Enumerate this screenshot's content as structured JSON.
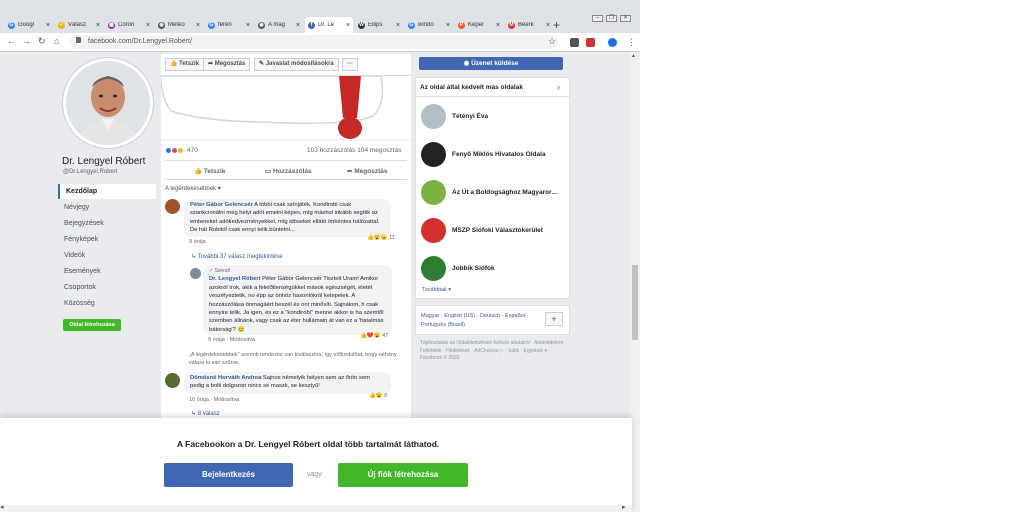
{
  "browser": {
    "tabs": [
      {
        "label": "Googl",
        "color": "#4285f4",
        "glyph": "G",
        "active": false
      },
      {
        "label": "Válasz",
        "color": "#f4b400",
        "glyph": "✓",
        "active": false
      },
      {
        "label": "Coron",
        "color": "#9c27b0",
        "glyph": "▦",
        "active": false
      },
      {
        "label": "Meteo",
        "color": "#555555",
        "glyph": "◉",
        "active": false
      },
      {
        "label": "feren",
        "color": "#4285f4",
        "glyph": "G",
        "active": false
      },
      {
        "label": "A mag",
        "color": "#555555",
        "glyph": "◉",
        "active": false
      },
      {
        "label": "Dr. Le",
        "color": "#4267b2",
        "glyph": "f",
        "active": true
      },
      {
        "label": "Ellips",
        "color": "#333333",
        "glyph": "W",
        "active": false
      },
      {
        "label": "windo",
        "color": "#4285f4",
        "glyph": "G",
        "active": false
      },
      {
        "label": "Képer",
        "color": "#ff5722",
        "glyph": "P",
        "active": false
      },
      {
        "label": "Beérk",
        "color": "#d93025",
        "glyph": "M",
        "active": false
      }
    ],
    "new_tab": "+",
    "url": "facebook.com/Dr.Lengyel.Robert/"
  },
  "profile": {
    "name": "Dr. Lengyel Róbert",
    "handle": "@Dr.Lengyel.Robert",
    "nav": [
      "Kezdőlap",
      "Névjegy",
      "Bejegyzések",
      "Fényképek",
      "Videók",
      "Események",
      "Csoportok",
      "Közösség"
    ],
    "create_page": "Oldal létrehozása"
  },
  "actions": {
    "like": "Tetszik",
    "share": "Megosztás",
    "suggest": "Javaslat módosításokra",
    "more": "···",
    "message": "Üzenet küldése"
  },
  "post": {
    "reactions": "470",
    "comments": "103 hozzászólás",
    "shares": "104 megosztás",
    "like_btn": "Tetszik",
    "comment_btn": "Hozzászólás",
    "share_btn": "Megosztás",
    "sort": "A legérdekesebbek ▾"
  },
  "comments": {
    "c1_name": "Péter Gábor Gelencsér",
    "c1_text": " A többi csak színjáték. Kondirobi csak szankcionálni meg helyi adót emelni képes, míg máshol inkább segítik az embereket adókedvezményekkel, míg idöseket ellátó önkéntes hálózattal. De hát Robitól csak ennyi telik.büntetni...",
    "c1_count": "11",
    "c1_time": "9 órája",
    "c1_more": "↳  További 37 válasz megtekintése",
    "r1_badge": "✓ Szerző",
    "r1_name": "Dr. Lengyel Róbert",
    "r1_text": " Péter Gábor Gelencsér Tisztelt Uram! Amikor azokról írok, akik a felelőtlenségükkel mások egészségét, életét veszélyeztetik, no épp az önhöz hasonlókról kelepelek. A hozzászólása önmagáért beszél és ont minősíti. Sajnálom, h csak ennyire telik. Ja igen, és ez a \"kondirobi\" menne akkor is ha szemtől szemben állnánk, vagy csak az éter hullámain át van ez a 'hatalmas bátorság'? 😊",
    "r1_count": "47",
    "r1_time": "9 órája · Módosítva",
    "note": "„A legérdekesebbek\" szerinti rendezés van kiválasztva, így előfordulhat, hogy néhány válasz ki van szűrve.",
    "c2_name": "Dömösné Horváth Andrea",
    "c2_text": " Sajnos némelyik helyen sem az őrön sem pedig a bolti dolgozon nincs se maszk, se kesztyű!",
    "c2_count": "6",
    "c2_time": "10 órája · Módosítva",
    "c2_more": "↳  8 válasz"
  },
  "right": {
    "liked_title": "Az oldal által kedvelt más oldalak",
    "pages": [
      {
        "name": "Tétényi Éva",
        "color": "#b0bec5"
      },
      {
        "name": "Fenyő Miklós Hivatalos Oldala",
        "color": "#222222"
      },
      {
        "name": "Az Út a Boldogsághoz Magyaror…",
        "color": "#7cb342"
      },
      {
        "name": "MSZP Siófoki Választókerület",
        "color": "#d32f2f"
      },
      {
        "name": "Jobbik Siófok",
        "color": "#2e7d32"
      }
    ],
    "see_more": "Továbbiak ▾",
    "languages": "Magyar · English (US) · Deutsch · Español · Português (Brasil)",
    "lang_add": "+",
    "footer": "Tájékoztatás az Oldalelemzések funkció adatairól · Adatvédelem · Feltételek · Hirdetések · AdChoices ▷ · Sütik · Egyebek ▾ · Facebook © 2020"
  },
  "banner": {
    "title": "A Facebookon a Dr. Lengyel Róbert oldal több tartalmát láthatod.",
    "login": "Bejelentkezés",
    "or": "vagy",
    "signup": "Új fiók létrehozása"
  }
}
